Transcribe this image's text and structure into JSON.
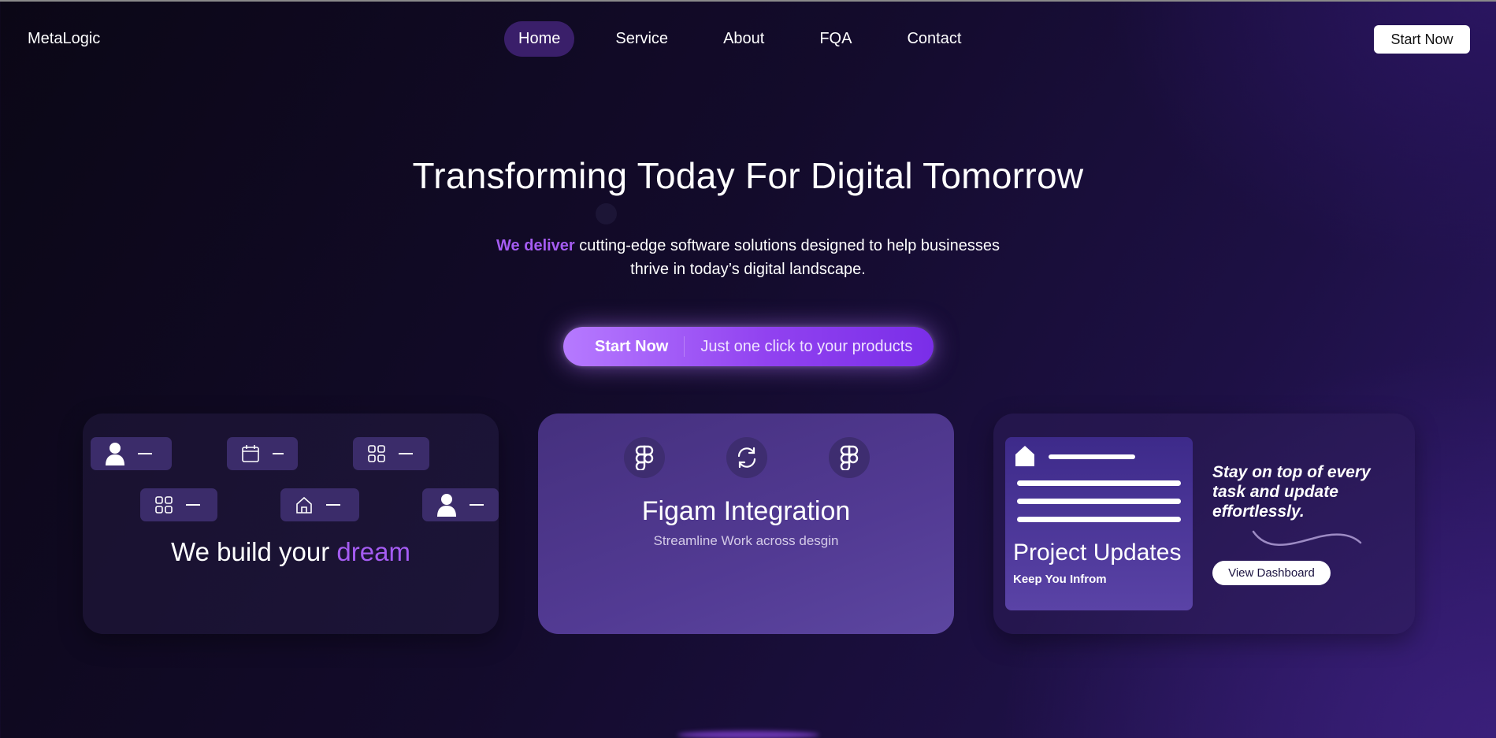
{
  "brand": {
    "name": "MetaLogic"
  },
  "nav": {
    "items": [
      {
        "label": "Home",
        "active": true
      },
      {
        "label": "Service",
        "active": false
      },
      {
        "label": "About",
        "active": false
      },
      {
        "label": "FQA",
        "active": false
      },
      {
        "label": "Contact",
        "active": false
      }
    ],
    "cta_label": "Start Now"
  },
  "hero": {
    "title": "Transforming Today For Digital Tomorrow",
    "subtitle_accent": "We deliver",
    "subtitle_line1": " cutting-edge software solutions designed to help businesses",
    "subtitle_line2": "thrive in today’s digital landscape.",
    "cta_main": "Start Now",
    "cta_hint": "Just one click to your products"
  },
  "cards": {
    "build": {
      "title_prefix": "We build your ",
      "title_accent": "dream",
      "pills": [
        {
          "icon": "user-icon"
        },
        {
          "icon": "calendar-icon"
        },
        {
          "icon": "grid-icon"
        },
        {
          "icon": "grid-icon"
        },
        {
          "icon": "home-icon"
        },
        {
          "icon": "user-icon"
        }
      ]
    },
    "figma": {
      "title": "Figam Integration",
      "subtitle": "Streamline Work across desgin",
      "icons": [
        "figma-icon",
        "sync-icon",
        "figma-icon"
      ]
    },
    "updates": {
      "mini_title": "Project Updates",
      "mini_subtitle": "Keep You Infrom",
      "tagline": "Stay on top of every task and update effortlessly.",
      "button_label": "View Dashboard"
    }
  },
  "colors": {
    "accent": "#a55cf2",
    "nav_active": "#3a1f6a",
    "card_purple": "#523a93"
  }
}
